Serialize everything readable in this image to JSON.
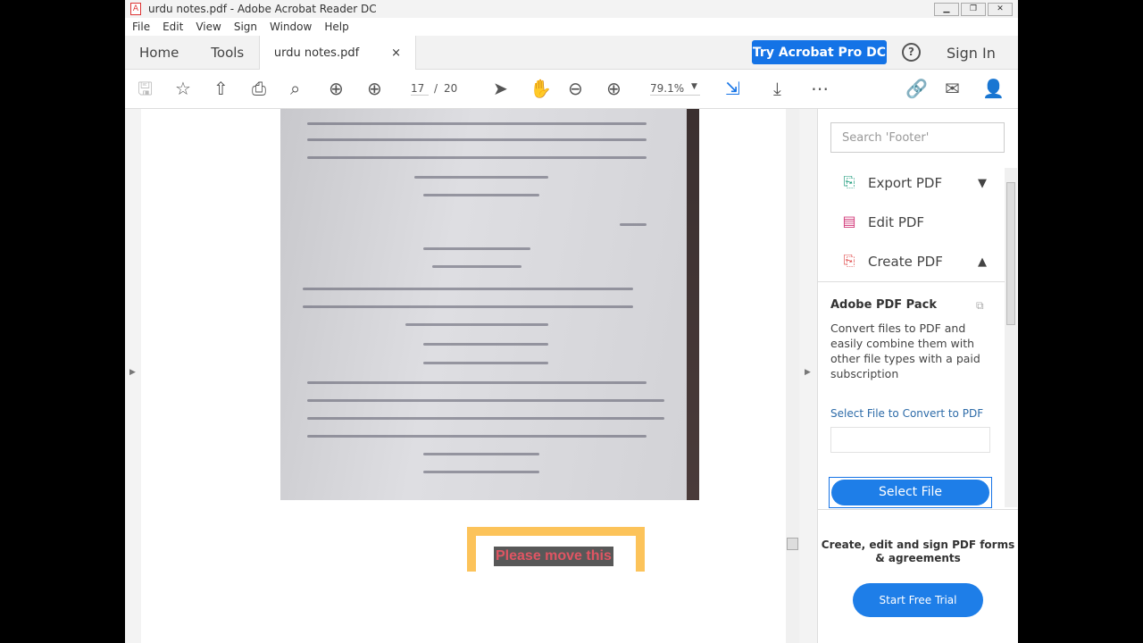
{
  "window": {
    "title": "urdu notes.pdf - Adobe Acrobat Reader DC",
    "controls": [
      "minimize",
      "restore",
      "close"
    ]
  },
  "menu": [
    "File",
    "Edit",
    "View",
    "Sign",
    "Window",
    "Help"
  ],
  "tabs": {
    "home": "Home",
    "tools": "Tools",
    "document": "urdu notes.pdf",
    "close": "×"
  },
  "header": {
    "try_pro": "Try Acrobat Pro DC",
    "help": "?",
    "sign_in": "Sign In"
  },
  "toolbar": {
    "page_current": "17",
    "page_sep": "/",
    "page_total": "20",
    "zoom": "79.1%"
  },
  "document": {
    "banner_text": "Please move this"
  },
  "right_pane": {
    "search_placeholder": "Search 'Footer'",
    "tools": [
      {
        "label": "Export PDF",
        "color": "#1a9a7a"
      },
      {
        "label": "Edit PDF",
        "color": "#d23a7a"
      },
      {
        "label": "Create PDF",
        "color": "#e04c4c"
      }
    ],
    "pack_title": "Adobe PDF Pack",
    "pack_desc": "Convert files to PDF and easily combine them with other file types with a paid subscription",
    "select_label": "Select File to Convert to PDF",
    "select_button": "Select File",
    "promo": "Create, edit and sign PDF forms & agreements",
    "trial_button": "Start Free Trial"
  },
  "colors": {
    "accent": "#1473e6",
    "banner_border": "#fcc35a",
    "banner_text": "#e05563"
  }
}
